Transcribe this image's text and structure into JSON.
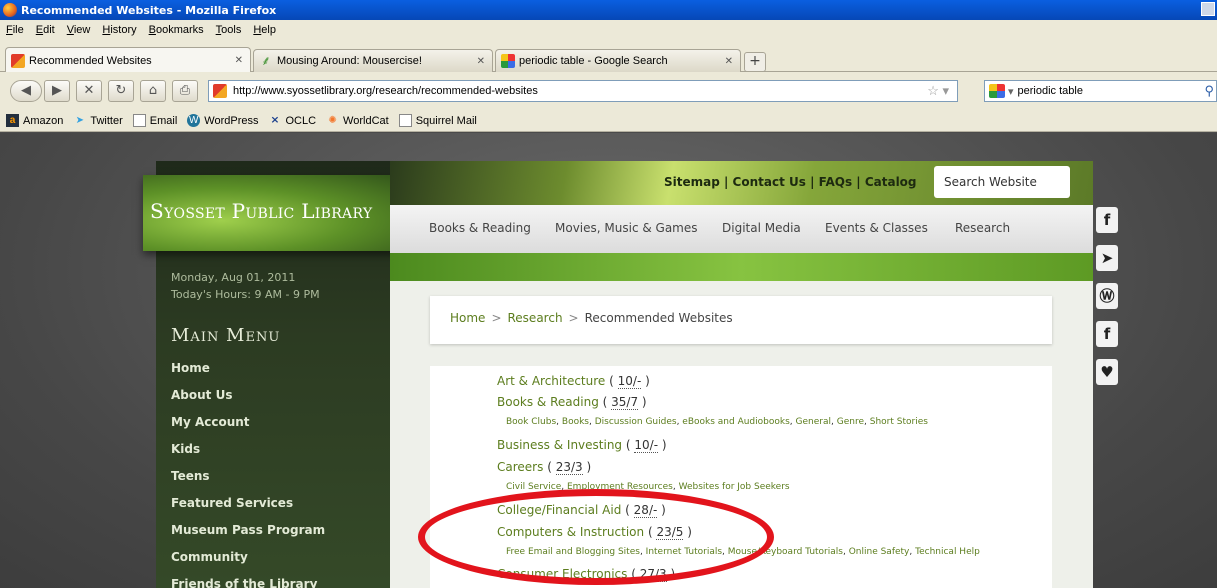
{
  "browser": {
    "title": "Recommended Websites - Mozilla Firefox",
    "menu": [
      "File",
      "Edit",
      "View",
      "History",
      "Bookmarks",
      "Tools",
      "Help"
    ],
    "tabs": [
      {
        "label": "Recommended Websites"
      },
      {
        "label": "Mousing Around: Mousercise!"
      },
      {
        "label": "periodic table - Google Search"
      }
    ],
    "url": "http://www.syossetlibrary.org/research/recommended-websites",
    "search_value": "periodic table",
    "bookmarks": [
      "Amazon",
      "Twitter",
      "Email",
      "WordPress",
      "OCLC",
      "WorldCat",
      "Squirrel Mail"
    ]
  },
  "site": {
    "logo": "Syosset Public Library",
    "date": "Monday, Aug 01, 2011",
    "hours": "Today's Hours: 9 AM - 9 PM",
    "menu_title": "Main Menu",
    "menu": [
      "Home",
      "About Us",
      "My Account",
      "Kids",
      "Teens",
      "Featured Services",
      "Museum Pass Program",
      "Community",
      "Friends of the Library"
    ],
    "header_links": "Sitemap | Contact Us | FAQs | Catalog",
    "search_placeholder": "Search Website",
    "nav": [
      "Books & Reading",
      "Movies, Music & Games",
      "Digital Media",
      "Events & Classes",
      "Research"
    ],
    "breadcrumb": {
      "home": "Home",
      "research": "Research",
      "current": "Recommended Websites"
    }
  },
  "categories": [
    {
      "name": "Art & Architecture",
      "count": "10/-",
      "subs": []
    },
    {
      "name": "Books & Reading",
      "count": "35/7",
      "subs": [
        "Book Clubs",
        "Books",
        "Discussion Guides",
        "eBooks and Audiobooks",
        "General",
        "Genre",
        "Short Stories"
      ]
    },
    {
      "name": "Business & Investing",
      "count": "10/-",
      "subs": []
    },
    {
      "name": "Careers",
      "count": "23/3",
      "subs": [
        "Civil Service",
        "Employment Resources",
        "Websites for Job Seekers"
      ]
    },
    {
      "name": "College/Financial Aid",
      "count": "28/-",
      "subs": []
    },
    {
      "name": "Computers & Instruction",
      "count": "23/5",
      "subs": [
        "Free Email and Blogging Sites",
        "Internet Tutorials",
        "Mouse/Keyboard Tutorials",
        "Online Safety",
        "Technical Help"
      ]
    },
    {
      "name": "Consumer Electronics",
      "count": "27/3",
      "subs": []
    }
  ],
  "social_icons": [
    "facebook-icon",
    "twitter-icon",
    "wordpress-icon",
    "foursquare-icon",
    "heart-icon"
  ],
  "colors": {
    "link_green": "#5c7d1e",
    "highlight_red": "#e2141c",
    "sidebar_dark": "#2c3b22"
  }
}
